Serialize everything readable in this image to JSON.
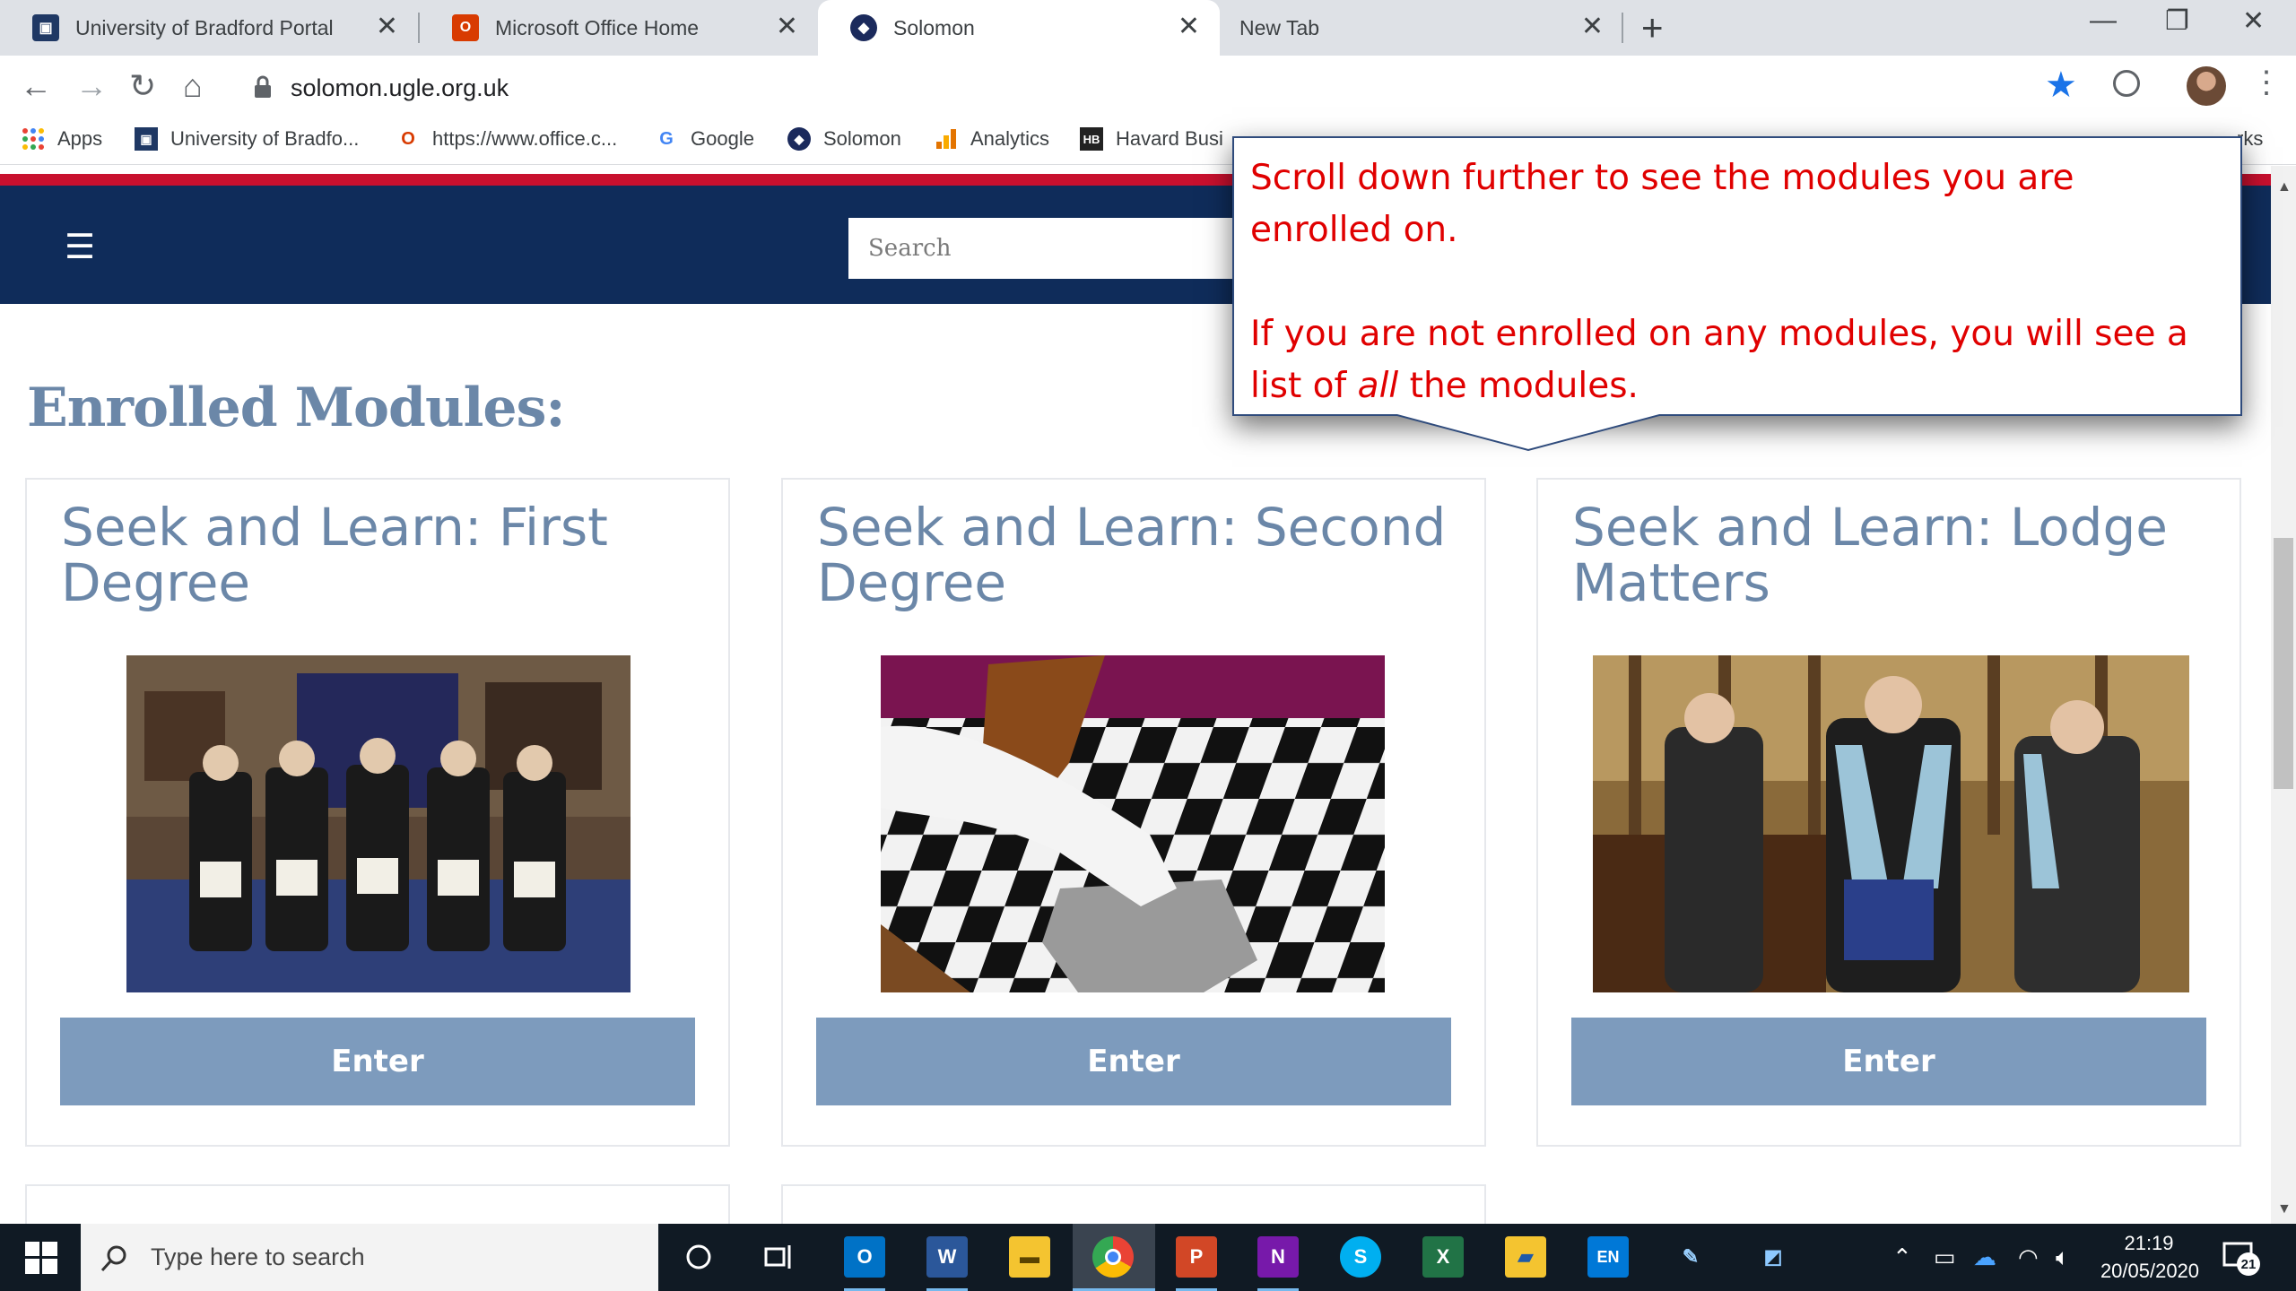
{
  "browser": {
    "tabs": [
      {
        "title": "University of Bradford Portal"
      },
      {
        "title": "Microsoft Office Home"
      },
      {
        "title": "Solomon",
        "active": true
      },
      {
        "title": "New Tab"
      }
    ],
    "new_tab_symbol": "+",
    "close_symbol": "✕",
    "window_controls": {
      "minimize": "—",
      "restore": "❐",
      "close": "✕"
    },
    "url": "solomon.ugle.org.uk",
    "star_color": "#1a73e8",
    "bookmarks": [
      {
        "label": "Apps",
        "icon": "apps-grid-icon"
      },
      {
        "label": "University of Bradfo...",
        "icon": "bradford-icon"
      },
      {
        "label": "https://www.office.c...",
        "icon": "office-icon"
      },
      {
        "label": "Google",
        "icon": "google-icon"
      },
      {
        "label": "Solomon",
        "icon": "solomon-icon"
      },
      {
        "label": "Analytics",
        "icon": "analytics-icon"
      },
      {
        "label": "Havard Busi",
        "icon": "hbr-icon"
      },
      {
        "label": "rks",
        "icon": "folder-icon"
      }
    ]
  },
  "site": {
    "brand_colors": {
      "navbar": "#0f2c5a",
      "stripe": "#c8102e",
      "accent": "#6b87a8",
      "button": "#7d9bbd"
    },
    "search_placeholder": "Search",
    "enrolled_heading": "Enrolled Modules:",
    "modules": [
      {
        "title": "Seek and Learn: First Degree",
        "button": "Enter"
      },
      {
        "title": "Seek and Learn: Second Degree",
        "button": "Enter"
      },
      {
        "title": "Seek and Learn: Lodge Matters",
        "button": "Enter"
      }
    ]
  },
  "callout": {
    "line1": "Scroll down further to see the modules you are enrolled on.",
    "line2_before": "If you are not enrolled on any modules, you will see a list of ",
    "line2_emphasis": "all",
    "line2_after": " the modules.",
    "text_color": "#e00000"
  },
  "taskbar": {
    "search_placeholder": "Type here to search",
    "time": "21:19",
    "date": "20/05/2020",
    "notification_count": "21",
    "language": "EN"
  }
}
